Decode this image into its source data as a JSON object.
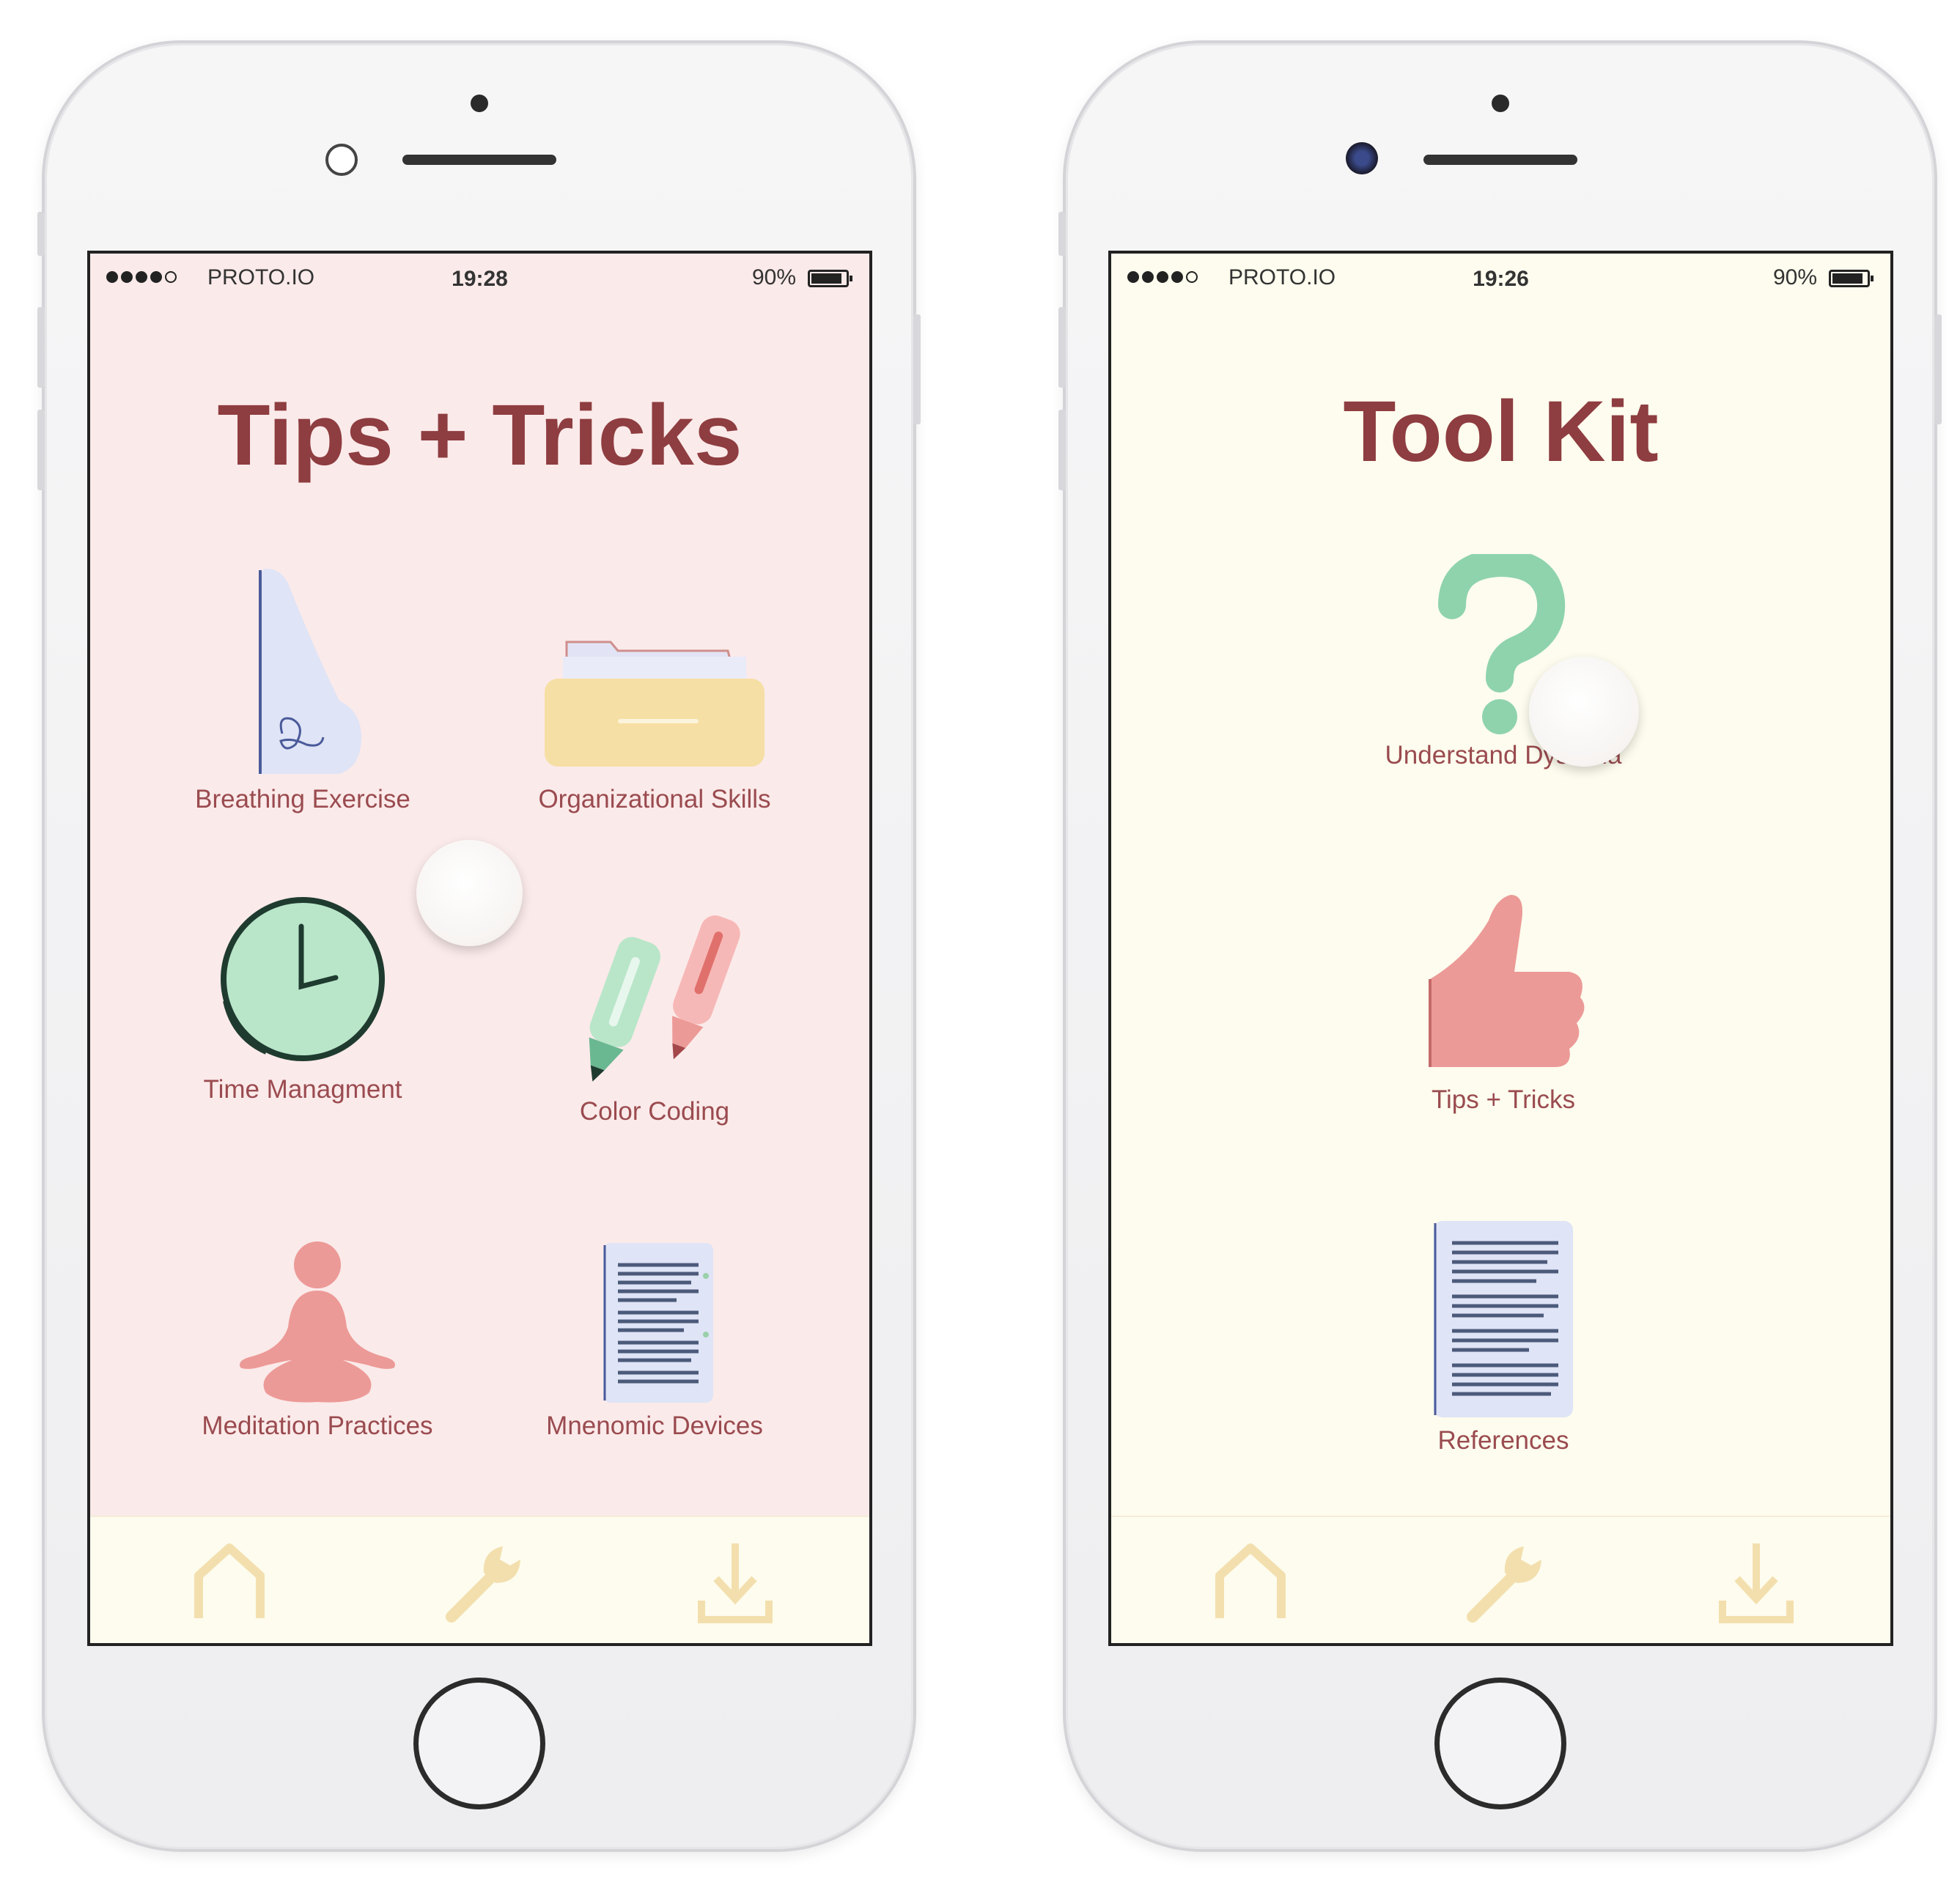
{
  "phones": [
    {
      "status": {
        "carrier": "PROTO.IO",
        "time": "19:28",
        "battery": "90%",
        "battery_level": 0.9
      },
      "title": "Tips + Tricks",
      "items": [
        {
          "label": "Breathing Exercise",
          "icon": "nose-icon"
        },
        {
          "label": "Organizational Skills",
          "icon": "folder-icon"
        },
        {
          "label": "Time Managment",
          "icon": "clock-icon"
        },
        {
          "label": "Color Coding",
          "icon": "highlighter-icon"
        },
        {
          "label": "Meditation Practices",
          "icon": "meditation-icon"
        },
        {
          "label": "Mnenomic Devices",
          "icon": "document-icon"
        }
      ],
      "background": "#fbeaea",
      "tabs": [
        {
          "icon": "home-icon"
        },
        {
          "icon": "wrench-icon"
        },
        {
          "icon": "download-icon"
        }
      ]
    },
    {
      "status": {
        "carrier": "PROTO.IO",
        "time": "19:26",
        "battery": "90%",
        "battery_level": 0.9
      },
      "title": "Tool Kit",
      "items": [
        {
          "label": "Understand Dyslexia",
          "icon": "question-mark-icon"
        },
        {
          "label": "Tips + Tricks",
          "icon": "thumbs-up-icon"
        },
        {
          "label": "References",
          "icon": "document-icon"
        }
      ],
      "background": "#fdfcee",
      "tabs": [
        {
          "icon": "home-icon"
        },
        {
          "icon": "wrench-icon"
        },
        {
          "icon": "download-icon"
        }
      ]
    }
  ],
  "colors": {
    "title": "#8e3d40",
    "label": "#9a4b4f",
    "tab_icon": "#f3dfae",
    "green": "#8fd3ad",
    "pink": "#ec9a97",
    "lavender": "#dfe4f6",
    "yellow": "#f6dfa4"
  }
}
